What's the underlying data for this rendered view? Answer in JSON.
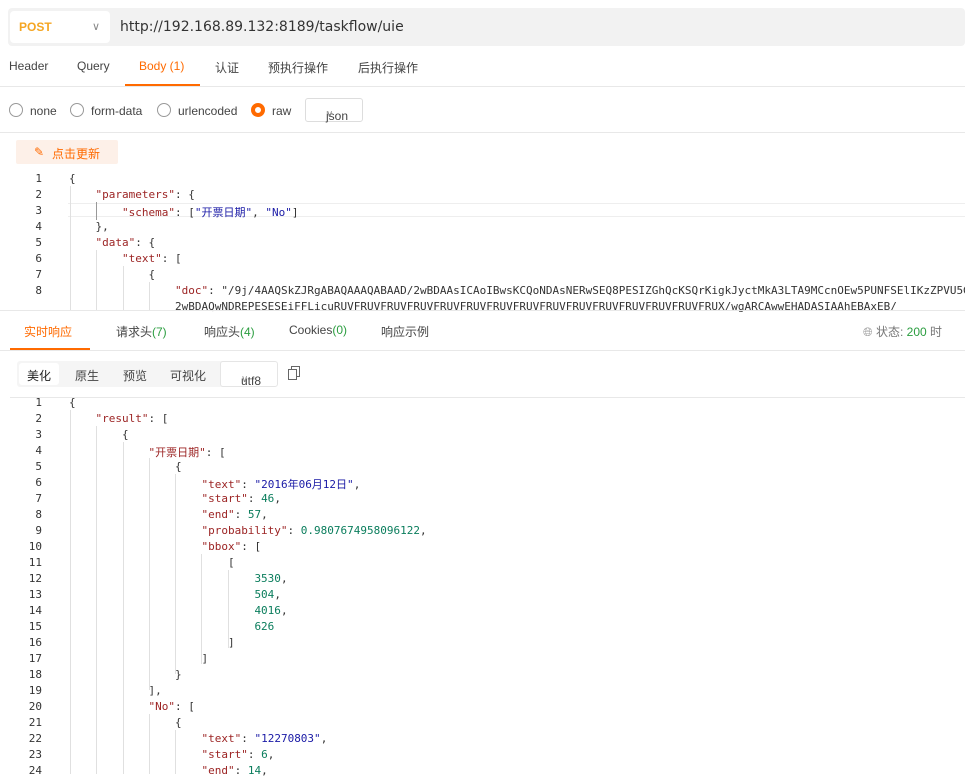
{
  "request": {
    "method": "POST",
    "url": "http://192.168.89.132:8189/taskflow/uie"
  },
  "tabs": [
    {
      "label": "Header",
      "active": false
    },
    {
      "label": "Query",
      "active": false
    },
    {
      "label": "Body (1)",
      "active": true
    },
    {
      "label": "认证",
      "active": false
    },
    {
      "label": "预执行操作",
      "active": false
    },
    {
      "label": "后执行操作",
      "active": false
    }
  ],
  "body_modes": [
    {
      "label": "none",
      "selected": false
    },
    {
      "label": "form-data",
      "selected": false
    },
    {
      "label": "urlencoded",
      "selected": false
    },
    {
      "label": "raw",
      "selected": true
    }
  ],
  "format_select": "json",
  "update_button": "点击更新",
  "request_body_lines": [
    {
      "n": "1",
      "t": "{"
    },
    {
      "n": "2",
      "t": "    \"parameters\": {"
    },
    {
      "n": "3",
      "t": "        \"schema\": [\"开票日期\", \"No\"]"
    },
    {
      "n": "4",
      "t": "    },"
    },
    {
      "n": "5",
      "t": "    \"data\": {"
    },
    {
      "n": "6",
      "t": "        \"text\": ["
    },
    {
      "n": "7",
      "t": "            {"
    },
    {
      "n": "8",
      "t": "                \"doc\": \"/9j/4AAQSkZJRgABAQAAAQABAAD/2wBDAAsICAoIBwsKCQoNDAsNERwSEQ8PESIZGhQcKSQrKigkJyctMkA3LTA9MCcnOEw5PUNFSElIKzZPVU5G"
    },
    {
      "n": "",
      "t": "                2wBDAQwNDREPESESEiFFLicuRUVFRUVFRUVFRUVFRUVFRUVFRUVFRUVFRUVFRUVFRUVFRUVFRUVFRUVFRUX/wgARCAwwEHADASIAAhEBAxEB/"
    }
  ],
  "response_tabs": [
    {
      "label": "实时响应",
      "count": "",
      "active": true
    },
    {
      "label": "请求头",
      "count": "(7)",
      "active": false
    },
    {
      "label": "响应头",
      "count": "(4)",
      "active": false
    },
    {
      "label": "Cookies",
      "count": "(0)",
      "active": false
    },
    {
      "label": "响应示例",
      "count": "",
      "active": false
    }
  ],
  "status": {
    "label": "状态:",
    "code": "200",
    "suffix": "时"
  },
  "view_modes": [
    "美化",
    "原生",
    "预览",
    "可视化"
  ],
  "encoding": "utf8",
  "response_lines": [
    {
      "n": "1",
      "t": "{"
    },
    {
      "n": "2",
      "t": "    \"result\": ["
    },
    {
      "n": "3",
      "t": "        {"
    },
    {
      "n": "4",
      "t": "            \"开票日期\": ["
    },
    {
      "n": "5",
      "t": "                {"
    },
    {
      "n": "6",
      "t": "                    \"text\": \"2016年06月12日\","
    },
    {
      "n": "7",
      "t": "                    \"start\": 46,"
    },
    {
      "n": "8",
      "t": "                    \"end\": 57,"
    },
    {
      "n": "9",
      "t": "                    \"probability\": 0.9807674958096122,"
    },
    {
      "n": "10",
      "t": "                    \"bbox\": ["
    },
    {
      "n": "11",
      "t": "                        ["
    },
    {
      "n": "12",
      "t": "                            3530,"
    },
    {
      "n": "13",
      "t": "                            504,"
    },
    {
      "n": "14",
      "t": "                            4016,"
    },
    {
      "n": "15",
      "t": "                            626"
    },
    {
      "n": "16",
      "t": "                        ]"
    },
    {
      "n": "17",
      "t": "                    ]"
    },
    {
      "n": "18",
      "t": "                }"
    },
    {
      "n": "19",
      "t": "            ],"
    },
    {
      "n": "20",
      "t": "            \"No\": ["
    },
    {
      "n": "21",
      "t": "                {"
    },
    {
      "n": "22",
      "t": "                    \"text\": \"12270803\","
    },
    {
      "n": "23",
      "t": "                    \"start\": 6,"
    },
    {
      "n": "24",
      "t": "                    \"end\": 14,"
    }
  ]
}
